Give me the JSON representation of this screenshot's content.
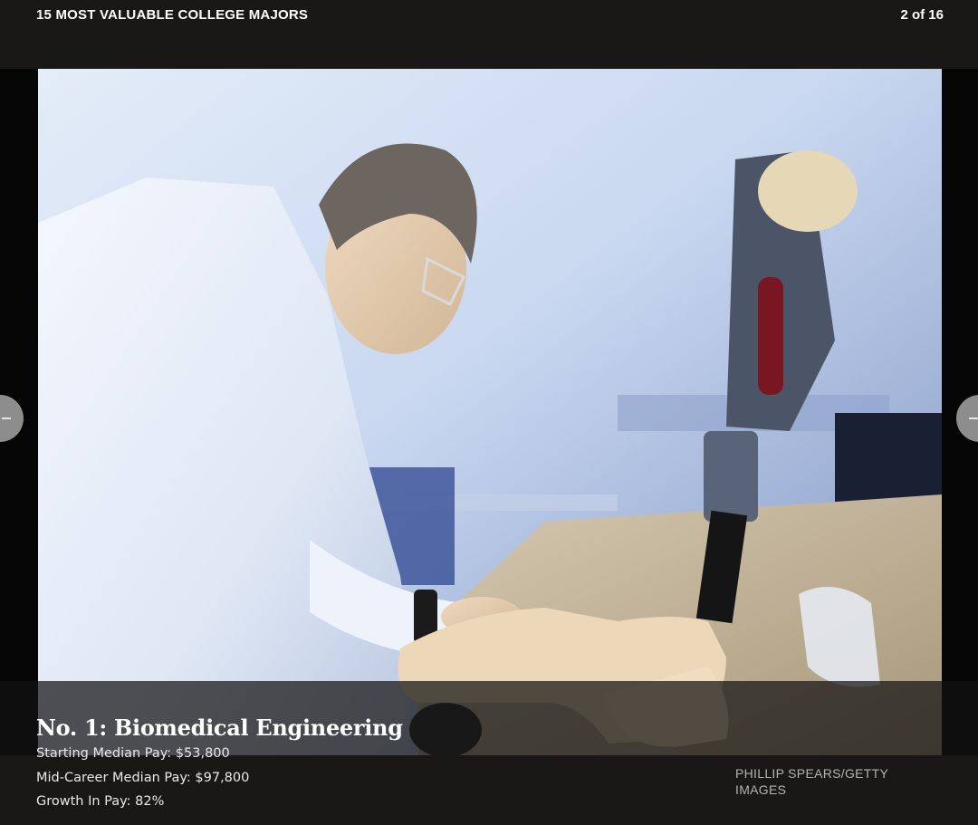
{
  "gallery": {
    "title": "15 MOST VALUABLE COLLEGE MAJORS",
    "counter": "2 of 16"
  },
  "slide": {
    "heading": "No. 1: Biomedical Engineering",
    "stats": [
      "Starting Median Pay: $53,800",
      "Mid-Career Median Pay: $97,800",
      "Growth In Pay: 82%"
    ],
    "photo_credit": "PHILLIP SPEARS/GETTY IMAGES"
  },
  "navigation": {
    "prev_icon": "arrow-left-icon",
    "next_icon": "arrow-right-icon"
  },
  "colors": {
    "background": "#1a1717",
    "nav_button": "#8d8d8d",
    "credit_text": "#b3b3b3"
  }
}
